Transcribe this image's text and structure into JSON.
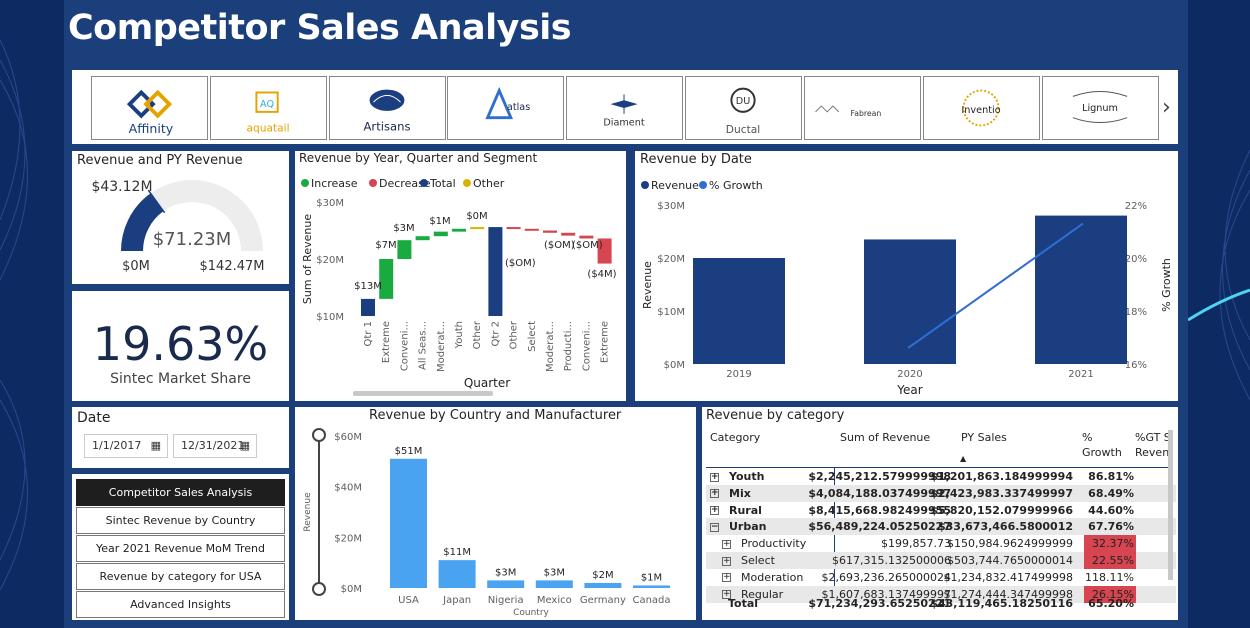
{
  "page_title": "Competitor Sales Analysis",
  "logos": [
    "Affinity",
    "aquatail",
    "Artisans",
    "atlas",
    "Diament",
    "Ductal",
    "Fabrean",
    "Inventio",
    "Lignum"
  ],
  "gauge": {
    "title": "Revenue and PY Revenue",
    "value_label": "$43.12M",
    "center_label": "$71.23M",
    "min_label": "$0M",
    "max_label": "$142.47M",
    "fraction": 0.302
  },
  "kpi": {
    "value": "19.63%",
    "label": "Sintec Market Share"
  },
  "date_filter": {
    "title": "Date",
    "start": "1/1/2017",
    "end": "12/31/2021"
  },
  "nav": [
    "Competitor Sales Analysis",
    "Sintec Revenue by Country",
    "Year 2021 Revenue MoM Trend",
    "Revenue by category for USA",
    "Advanced Insights"
  ],
  "colors": {
    "navy": "#1a3e80",
    "increase": "#1aab40",
    "decrease": "#d64550",
    "other": "#d9b300",
    "light_blue": "#4aa3f0",
    "trend": "#2f6fd1",
    "bad": "#d64550"
  },
  "chart_data": [
    {
      "type": "bar",
      "title": "Revenue by Year, Quarter and Segment",
      "legend": [
        "Increase",
        "Decrease",
        "Total",
        "Other"
      ],
      "legend_position": "top-left",
      "xlabel": "Quarter",
      "ylabel": "Sum of Revenue",
      "y_ticks": [
        "$30M",
        "$20M",
        "$10M"
      ],
      "ylim": [
        10,
        30
      ],
      "categories": [
        "Qtr 1",
        "Extreme",
        "Conveni...",
        "All Seas...",
        "Moderat...",
        "Youth",
        "Other",
        "Qtr 2",
        "Other",
        "Select",
        "Moderat...",
        "Producti...",
        "Conveni...",
        "Extreme"
      ],
      "bars": [
        {
          "kind": "Total",
          "start": 10,
          "end": 13
        },
        {
          "kind": "Increase",
          "start": 13,
          "end": 20
        },
        {
          "kind": "Increase",
          "start": 20,
          "end": 23.3
        },
        {
          "kind": "Increase",
          "start": 23.3,
          "end": 24
        },
        {
          "kind": "Increase",
          "start": 24,
          "end": 24.8
        },
        {
          "kind": "Increase",
          "start": 24.8,
          "end": 25.3
        },
        {
          "kind": "Other",
          "start": 25.3,
          "end": 25.6
        },
        {
          "kind": "Total",
          "start": 10,
          "end": 25.6
        },
        {
          "kind": "Decrease",
          "start": 25.6,
          "end": 25.3
        },
        {
          "kind": "Decrease",
          "start": 25.3,
          "end": 25
        },
        {
          "kind": "Decrease",
          "start": 25,
          "end": 24.6
        },
        {
          "kind": "Decrease",
          "start": 24.6,
          "end": 24.1
        },
        {
          "kind": "Decrease",
          "start": 24.1,
          "end": 23.6
        },
        {
          "kind": "Decrease",
          "start": 23.6,
          "end": 19.2
        }
      ],
      "data_labels": [
        "$13M",
        "$7M",
        "$3M",
        "$1M",
        "$0M",
        "($OM)",
        "($OM)",
        "($OM)",
        "($4M)"
      ]
    },
    {
      "type": "bar",
      "title": "Revenue by Date",
      "legend": [
        "Revenue",
        "% Growth"
      ],
      "legend_position": "top-left",
      "xlabel": "Year",
      "ylabel": "Revenue",
      "y2label": "% Growth",
      "categories": [
        "2019",
        "2020",
        "2021"
      ],
      "series": [
        {
          "name": "Revenue",
          "values": [
            20,
            23.5,
            28
          ]
        },
        {
          "name": "% Growth",
          "values": [
            null,
            16.6,
            21.3
          ]
        }
      ],
      "ylim": [
        0,
        30
      ],
      "y2lim": [
        16,
        22
      ],
      "y_ticks": [
        "$30M",
        "$20M",
        "$10M",
        "$0M"
      ],
      "y2_ticks": [
        "22%",
        "20%",
        "18%",
        "16%"
      ]
    },
    {
      "type": "bar",
      "title": "Revenue by Country and Manufacturer",
      "xlabel": "Country",
      "ylabel": "Revenue",
      "categories": [
        "USA",
        "Japan",
        "Nigeria",
        "Mexico",
        "Germany",
        "Canada"
      ],
      "values": [
        51,
        11,
        3,
        3,
        2,
        1
      ],
      "value_labels": [
        "$51M",
        "$11M",
        "$3M",
        "$3M",
        "$2M",
        "$1M"
      ],
      "ylim": [
        0,
        60
      ],
      "y_ticks": [
        "$60M",
        "$40M",
        "$20M",
        "$0M"
      ]
    },
    {
      "type": "table",
      "title": "Revenue by category",
      "columns": [
        "Category",
        "Sum of Revenue",
        "PY Sales",
        "%\nGrowth",
        "%GT S\nReven"
      ],
      "rows": [
        {
          "name": "Youth",
          "level": 0,
          "expand": "+",
          "revenue": "$2,245,212.579999998",
          "py": "$1,201,863.184999994",
          "growth": "86.81%",
          "bad": false
        },
        {
          "name": "Mix",
          "level": 0,
          "expand": "+",
          "revenue": "$4,084,188.037499997",
          "py": "$2,423,983.337499997",
          "growth": "68.49%",
          "bad": false
        },
        {
          "name": "Rural",
          "level": 0,
          "expand": "+",
          "revenue": "$8,415,668.982499955",
          "py": "$5,820,152.079999966",
          "growth": "44.60%",
          "bad": false
        },
        {
          "name": "Urban",
          "level": 0,
          "expand": "−",
          "revenue": "$56,489,224.05250227",
          "py": "$33,673,466.5800012",
          "growth": "67.76%",
          "bad": false
        },
        {
          "name": "Productivity",
          "level": 1,
          "expand": "+",
          "revenue": "$199,857.73",
          "py": "$150,984.9624999999",
          "growth": "32.37%",
          "bad": true
        },
        {
          "name": "Select",
          "level": 1,
          "expand": "+",
          "revenue": "$617,315.132500006",
          "py": "$503,744.7650000014",
          "growth": "22.55%",
          "bad": true
        },
        {
          "name": "Moderation",
          "level": 1,
          "expand": "+",
          "revenue": "$2,693,236.265000024",
          "py": "$1,234,832.417499998",
          "growth": "118.11%",
          "bad": false
        },
        {
          "name": "Regular",
          "level": 1,
          "expand": "+",
          "revenue": "$1,607,683.137499997",
          "py": "$1,274,444.347499998",
          "growth": "26.15%",
          "bad": true
        }
      ],
      "total": {
        "name": "Total",
        "revenue": "$71,234,293.65250221",
        "py": "$43,119,465.18250116",
        "growth": "65.20%"
      }
    }
  ]
}
